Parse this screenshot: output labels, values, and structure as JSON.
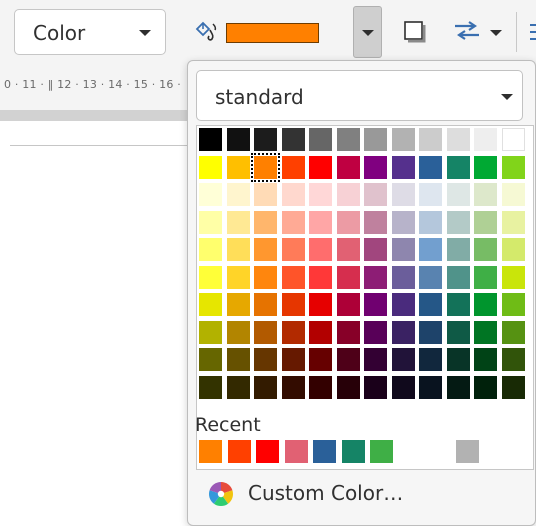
{
  "toolbar": {
    "fill_type": "Color",
    "current_color": "#ff8000",
    "fill_icon": "paint-bucket-icon",
    "shadow_icon": "shadow-icon",
    "arrange_icon": "arrange-icon",
    "extra_icon": "arrow-icon"
  },
  "ruler": {
    "numbers": "0 · 11 · ‖ 12 · 13 · 14 · 15 · 16 ·"
  },
  "popover": {
    "palette_name": "standard",
    "palette_rows": [
      [
        "#000000",
        "#111111",
        "#1c1c1c",
        "#333333",
        "#666666",
        "#808080",
        "#999999",
        "#b2b2b2",
        "#cccccc",
        "#dddddd",
        "#eeeeee",
        "#ffffff"
      ],
      [
        "#ffff00",
        "#ffbf00",
        "#ff8000",
        "#ff4000",
        "#ff0000",
        "#bf0041",
        "#800080",
        "#55308d",
        "#2a6099",
        "#158466",
        "#00a933",
        "#81d41a"
      ],
      [
        "#ffffd7",
        "#fff5ce",
        "#ffdbb6",
        "#ffd8ce",
        "#ffd7d7",
        "#f7d1d5",
        "#e0c2cd",
        "#dedce6",
        "#dee6ef",
        "#dee7e5",
        "#dde8cb",
        "#f6f9d4"
      ],
      [
        "#ffffa6",
        "#ffe994",
        "#ffb66c",
        "#ffaa95",
        "#ffa6a6",
        "#ec9ba4",
        "#bf819e",
        "#b7b3ca",
        "#b4c7dc",
        "#b3cac7",
        "#afd095",
        "#e8f2a1"
      ],
      [
        "#ffff6d",
        "#ffde59",
        "#ff972f",
        "#ff7b59",
        "#ff6d6d",
        "#e16173",
        "#a1467e",
        "#8e86ae",
        "#729fcf",
        "#81aca6",
        "#77bc65",
        "#d4ea6b"
      ],
      [
        "#ffff38",
        "#ffd428",
        "#ff860d",
        "#ff5429",
        "#ff3838",
        "#d62e4e",
        "#8d1d75",
        "#6b5e9b",
        "#5983b0",
        "#50938a",
        "#3faf46",
        "#c9e50a"
      ],
      [
        "#e6e600",
        "#e6a800",
        "#e67300",
        "#e63600",
        "#e60000",
        "#ad0037",
        "#700070",
        "#4a2b7d",
        "#255787",
        "#137259",
        "#00952d",
        "#6fbc16"
      ],
      [
        "#b2b200",
        "#b28500",
        "#b25a00",
        "#b22a00",
        "#b20000",
        "#870028",
        "#580058",
        "#3a2263",
        "#1e436a",
        "#0f5a46",
        "#007523",
        "#569212"
      ],
      [
        "#666600",
        "#665100",
        "#663600",
        "#661900",
        "#660000",
        "#4e0018",
        "#330033",
        "#211339",
        "#11273d",
        "#083427",
        "#004316",
        "#31540a"
      ],
      [
        "#333300",
        "#332900",
        "#331b00",
        "#330c00",
        "#330000",
        "#270008",
        "#1a001a",
        "#10091c",
        "#09131f",
        "#041a13",
        "#00210b",
        "#182a05"
      ]
    ],
    "selected_color": "#ff8000",
    "recent_label": "Recent",
    "recent_colors": [
      "#ff8000",
      "#ff4000",
      "#ff0000",
      "#e16173",
      "#2a6099",
      "#158466",
      "#3faf46",
      null,
      null,
      "#b2b2b2"
    ],
    "custom_color_label": "Custom Color…"
  }
}
